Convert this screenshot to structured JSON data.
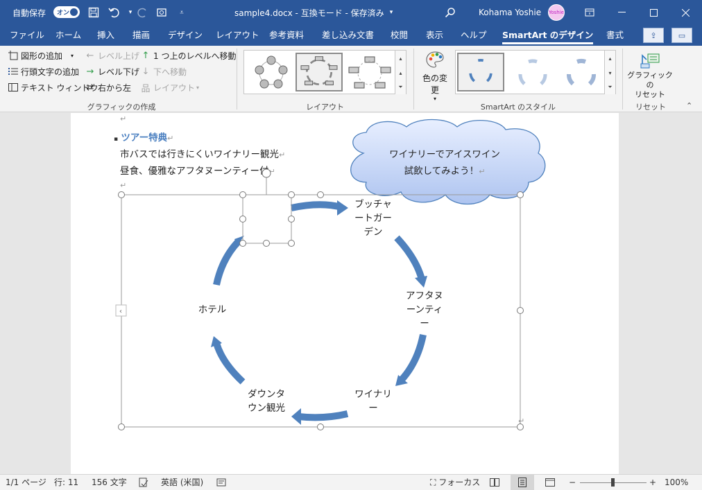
{
  "titlebar": {
    "autosave_label": "自動保存",
    "autosave_state": "オン",
    "document_title": "sample4.docx  -  互換モード - 保存済み",
    "user_name": "Kohama Yoshie",
    "avatar_text": "Yoshie",
    "icons": [
      "save-icon",
      "undo-icon",
      "redo-icon",
      "touch-mode-icon",
      "customize-qat-icon",
      "search-icon",
      "ribbon-display-icon",
      "minimize-icon",
      "maximize-icon",
      "close-icon"
    ]
  },
  "tabs": [
    "ファイル",
    "ホーム",
    "挿入",
    "描画",
    "デザイン",
    "レイアウト",
    "参考資料",
    "差し込み文書",
    "校閲",
    "表示",
    "ヘルプ",
    "SmartArt のデザイン",
    "書式"
  ],
  "active_tab": "SmartArt のデザイン",
  "ribbon": {
    "create_group": {
      "label": "グラフィックの作成",
      "add_shape": "図形の追加",
      "add_bullet": "行頭文字の追加",
      "text_pane": "テキスト ウィンドウ",
      "promote": "レベル上げ",
      "demote": "レベル下げ",
      "right_to_left": "右から左",
      "move_up": "1 つ上のレベルへ移動",
      "move_down": "下へ移動",
      "layout": "レイアウト"
    },
    "layout_group": {
      "label": "レイアウト"
    },
    "styles_group": {
      "label": "SmartArt のスタイル",
      "change_colors": "色の変更"
    },
    "reset_group": {
      "label": "リセット",
      "reset_line1": "グラフィックの",
      "reset_line2": "リセット"
    },
    "colors": {
      "accent": "#2b579a",
      "arrow": "#4f81bd"
    }
  },
  "document": {
    "heading": "ツアー特典",
    "line1": "市バスでは行きにくいワイナリー観光",
    "line2": "昼食、優雅なアフタヌーンティー付",
    "callout_line1": "ワイナリーでアイスワイン",
    "callout_line2": "試飲してみよう！",
    "cycle_nodes": [
      {
        "lines": [
          "ブッチャ",
          "ートガー",
          "デン"
        ]
      },
      {
        "lines": [
          "アフタヌ",
          "ーンティ",
          "ー"
        ]
      },
      {
        "lines": [
          "ワイナリ",
          "ー"
        ]
      },
      {
        "lines": [
          "ダウンタ",
          "ウン観光"
        ]
      },
      {
        "lines": [
          "ホテル"
        ]
      }
    ]
  },
  "statusbar": {
    "page": "1/1 ページ",
    "line": "行: 11",
    "chars": "156 文字",
    "language": "英語 (米国)",
    "focus": "フォーカス",
    "zoom": "100%"
  }
}
